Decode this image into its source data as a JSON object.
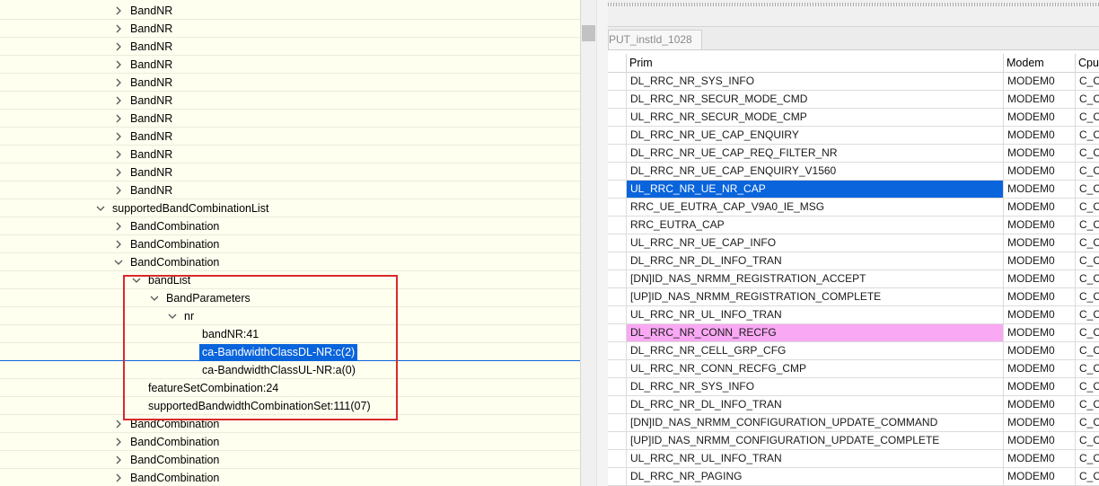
{
  "tree": {
    "rows": [
      {
        "label": "BandNR",
        "indent": 2,
        "arrow": "right"
      },
      {
        "label": "BandNR",
        "indent": 2,
        "arrow": "right"
      },
      {
        "label": "BandNR",
        "indent": 2,
        "arrow": "right"
      },
      {
        "label": "BandNR",
        "indent": 2,
        "arrow": "right"
      },
      {
        "label": "BandNR",
        "indent": 2,
        "arrow": "right"
      },
      {
        "label": "BandNR",
        "indent": 2,
        "arrow": "right"
      },
      {
        "label": "BandNR",
        "indent": 2,
        "arrow": "right"
      },
      {
        "label": "BandNR",
        "indent": 2,
        "arrow": "right"
      },
      {
        "label": "BandNR",
        "indent": 2,
        "arrow": "right"
      },
      {
        "label": "BandNR",
        "indent": 2,
        "arrow": "right"
      },
      {
        "label": "BandNR",
        "indent": 2,
        "arrow": "right"
      },
      {
        "label": "supportedBandCombinationList",
        "indent": 1,
        "arrow": "down"
      },
      {
        "label": "BandCombination",
        "indent": 2,
        "arrow": "right"
      },
      {
        "label": "BandCombination",
        "indent": 2,
        "arrow": "right"
      },
      {
        "label": "BandCombination",
        "indent": 2,
        "arrow": "down"
      },
      {
        "label": "bandList",
        "indent": 3,
        "arrow": "down"
      },
      {
        "label": "BandParameters",
        "indent": 4,
        "arrow": "down"
      },
      {
        "label": "nr",
        "indent": 5,
        "arrow": "down"
      },
      {
        "label": "bandNR:41",
        "indent": 6,
        "arrow": "none"
      },
      {
        "label": "ca-BandwidthClassDL-NR:c(2)",
        "indent": 6,
        "arrow": "none",
        "selected": true
      },
      {
        "label": "ca-BandwidthClassUL-NR:a(0)",
        "indent": 6,
        "arrow": "none"
      },
      {
        "label": "featureSetCombination:24",
        "indent": 3,
        "arrow": "none"
      },
      {
        "label": "supportedBandwidthCombinationSet:111(07)",
        "indent": 3,
        "arrow": "none"
      },
      {
        "label": "BandCombination",
        "indent": 2,
        "arrow": "right"
      },
      {
        "label": "BandCombination",
        "indent": 2,
        "arrow": "right"
      },
      {
        "label": "BandCombination",
        "indent": 2,
        "arrow": "right"
      },
      {
        "label": "BandCombination",
        "indent": 2,
        "arrow": "right"
      }
    ]
  },
  "right": {
    "tab_label": "PUT_instId_1028",
    "columns": {
      "prim": "Prim",
      "modem": "Modem",
      "cpu": "Cpu"
    },
    "rows": [
      {
        "prim": "DL_RRC_NR_SYS_INFO",
        "modem": "MODEM0",
        "cpu": "C_C"
      },
      {
        "prim": "DL_RRC_NR_SECUR_MODE_CMD",
        "modem": "MODEM0",
        "cpu": "C_C"
      },
      {
        "prim": "UL_RRC_NR_SECUR_MODE_CMP",
        "modem": "MODEM0",
        "cpu": "C_C"
      },
      {
        "prim": "DL_RRC_NR_UE_CAP_ENQUIRY",
        "modem": "MODEM0",
        "cpu": "C_C"
      },
      {
        "prim": "DL_RRC_NR_UE_CAP_REQ_FILTER_NR",
        "modem": "MODEM0",
        "cpu": "C_C"
      },
      {
        "prim": "DL_RRC_NR_UE_CAP_ENQUIRY_V1560",
        "modem": "MODEM0",
        "cpu": "C_C"
      },
      {
        "prim": "UL_RRC_NR_UE_NR_CAP",
        "modem": "MODEM0",
        "cpu": "C_C",
        "state": "selected"
      },
      {
        "prim": "RRC_UE_EUTRA_CAP_V9A0_IE_MSG",
        "modem": "MODEM0",
        "cpu": "C_C"
      },
      {
        "prim": "RRC_EUTRA_CAP",
        "modem": "MODEM0",
        "cpu": "C_C"
      },
      {
        "prim": "UL_RRC_NR_UE_CAP_INFO",
        "modem": "MODEM0",
        "cpu": "C_C"
      },
      {
        "prim": "DL_RRC_NR_DL_INFO_TRAN",
        "modem": "MODEM0",
        "cpu": "C_C"
      },
      {
        "prim": "[DN]ID_NAS_NRMM_REGISTRATION_ACCEPT",
        "modem": "MODEM0",
        "cpu": "C_C"
      },
      {
        "prim": "[UP]ID_NAS_NRMM_REGISTRATION_COMPLETE",
        "modem": "MODEM0",
        "cpu": "C_C"
      },
      {
        "prim": "UL_RRC_NR_UL_INFO_TRAN",
        "modem": "MODEM0",
        "cpu": "C_C"
      },
      {
        "prim": "DL_RRC_NR_CONN_RECFG",
        "modem": "MODEM0",
        "cpu": "C_C",
        "state": "highlight"
      },
      {
        "prim": "DL_RRC_NR_CELL_GRP_CFG",
        "modem": "MODEM0",
        "cpu": "C_C"
      },
      {
        "prim": "UL_RRC_NR_CONN_RECFG_CMP",
        "modem": "MODEM0",
        "cpu": "C_C"
      },
      {
        "prim": "DL_RRC_NR_SYS_INFO",
        "modem": "MODEM0",
        "cpu": "C_C"
      },
      {
        "prim": "DL_RRC_NR_DL_INFO_TRAN",
        "modem": "MODEM0",
        "cpu": "C_C"
      },
      {
        "prim": "[DN]ID_NAS_NRMM_CONFIGURATION_UPDATE_COMMAND",
        "modem": "MODEM0",
        "cpu": "C_C"
      },
      {
        "prim": "[UP]ID_NAS_NRMM_CONFIGURATION_UPDATE_COMPLETE",
        "modem": "MODEM0",
        "cpu": "C_C"
      },
      {
        "prim": "UL_RRC_NR_UL_INFO_TRAN",
        "modem": "MODEM0",
        "cpu": "C_C"
      },
      {
        "prim": "DL_RRC_NR_PAGING",
        "modem": "MODEM0",
        "cpu": "C_C"
      }
    ]
  },
  "colors": {
    "tree_background": "#fffff0",
    "selection": "#0a64dc",
    "highlight_row": "#f9a8f3",
    "annotation_box": "#d82a2a"
  },
  "icons": {
    "collapsed": "chevron-right-icon",
    "expanded": "chevron-down-icon"
  }
}
